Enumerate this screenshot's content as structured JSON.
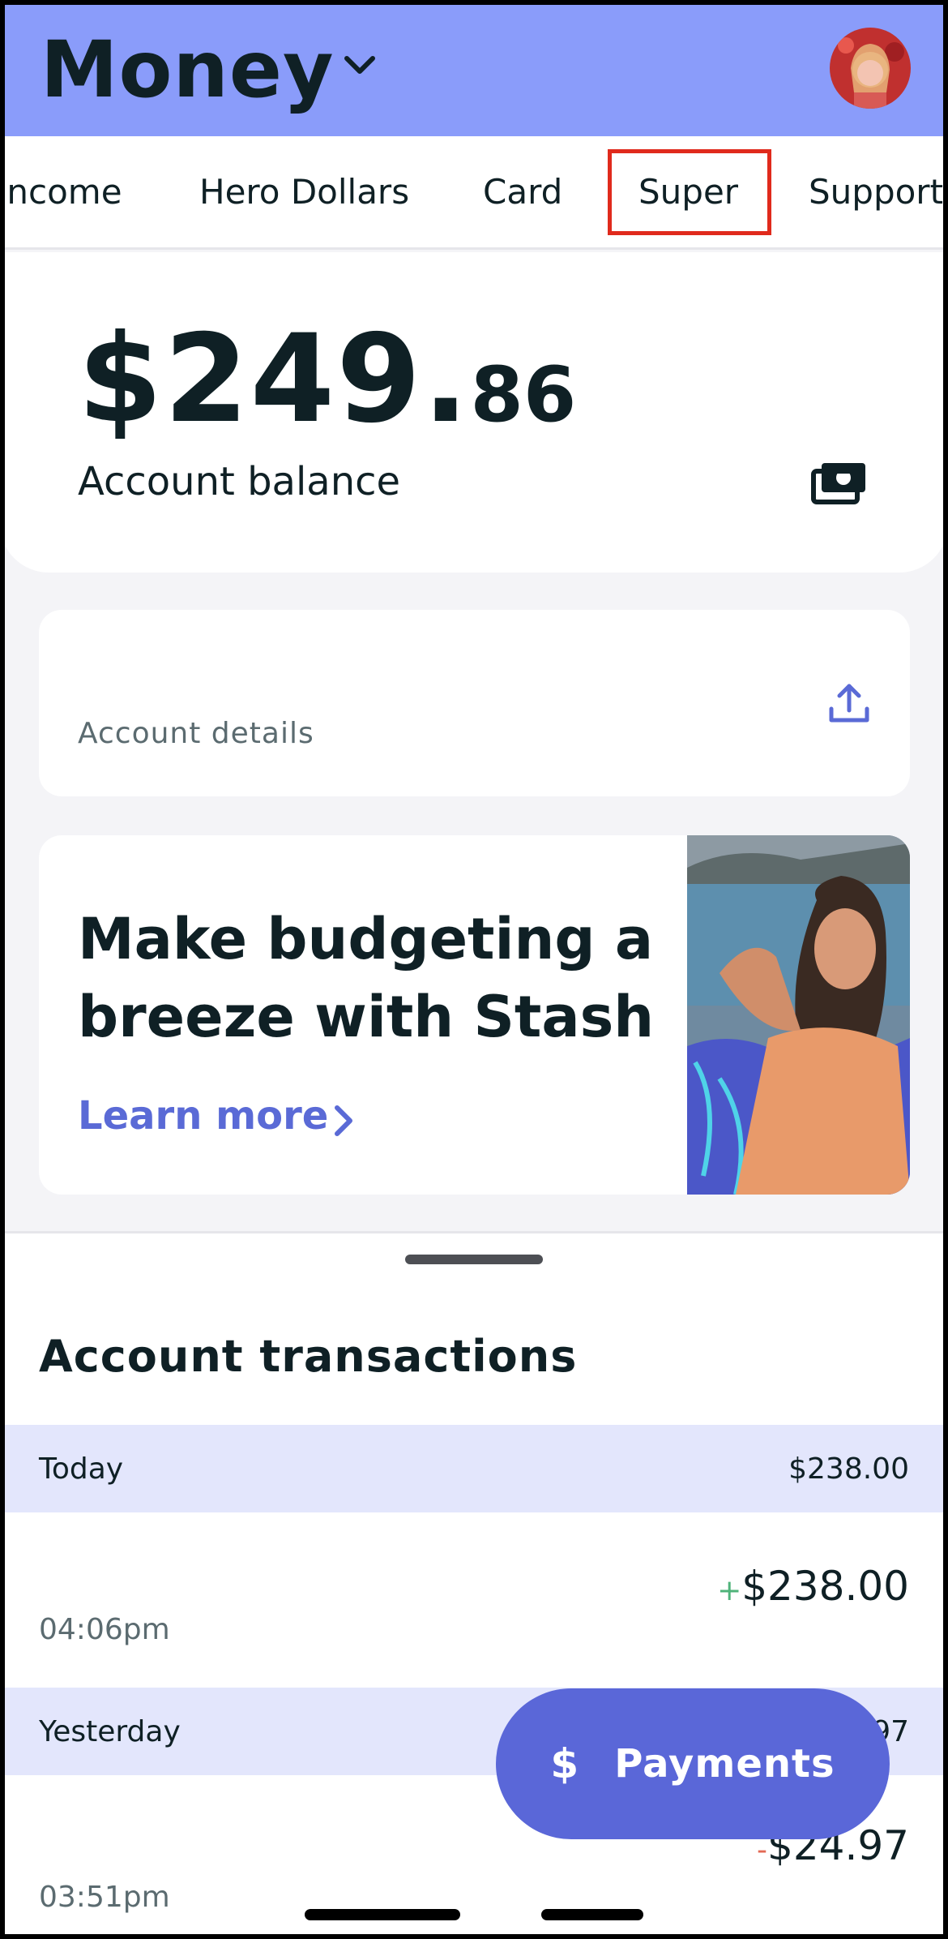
{
  "header": {
    "title": "Money"
  },
  "tabs": [
    {
      "label": "Income"
    },
    {
      "label": "Hero Dollars"
    },
    {
      "label": "Card"
    },
    {
      "label": "Super"
    },
    {
      "label": "Support"
    }
  ],
  "highlight_color": "#e02a1c",
  "balance": {
    "dollars": "$249.",
    "cents": "86",
    "label": "Account balance"
  },
  "account_details": {
    "label": "Account details"
  },
  "promo": {
    "headline": "Make budgeting a breeze with Stash",
    "link_label": "Learn more"
  },
  "transactions": {
    "title": "Account transactions",
    "groups": [
      {
        "label": "Today",
        "total": "$238.00",
        "items": [
          {
            "time": "04:06pm",
            "sign": "+",
            "amount": "$238.00"
          }
        ]
      },
      {
        "label": "Yesterday",
        "total": "97",
        "items": [
          {
            "time": "03:51pm",
            "sign": "-",
            "amount": "$24.97"
          }
        ]
      }
    ]
  },
  "fab": {
    "icon": "$",
    "label": "Payments"
  },
  "colors": {
    "header_bg": "#8a9cfa",
    "accent": "#5a67d8",
    "positive": "#4fb37a",
    "negative": "#e36a55",
    "group_bg": "#e3e6fc"
  }
}
